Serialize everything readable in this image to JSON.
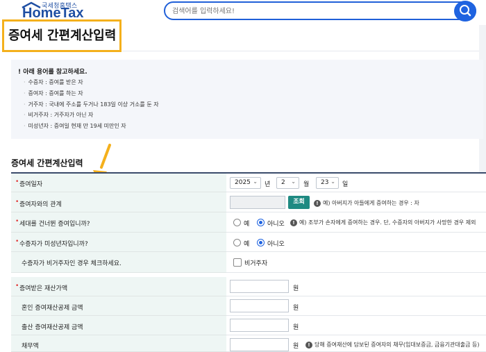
{
  "header": {
    "logo_sub": "국세청홈택스",
    "logo_main": "HomeTax",
    "search_placeholder": "검색어를 입력하세요!"
  },
  "page_title": "증여세 간편계산입력",
  "notice": {
    "heading": "! 아래 용어를 참고하세요.",
    "items": [
      "수증자 : 증여를 받은 자",
      "증여자 : 증여를 하는 자",
      "거주자 : 국내에 주소를 두거나 183일 이상 거소를 둔 자",
      "비거주자 : 거주자가 아닌 자",
      "미성년자 : 증여일 현재 만 19세 미만인 자"
    ]
  },
  "section_title": "증여세 간편계산입력",
  "form": {
    "date": {
      "label": "증여일자",
      "year": "2025",
      "year_unit": "년",
      "month": "2",
      "month_unit": "월",
      "day": "23",
      "day_unit": "일"
    },
    "relation": {
      "label": "증여자와의 관계",
      "button": "조회",
      "hint": "예) 아버지가 아들에게 증여하는 경우 : 자"
    },
    "generation_skip": {
      "label": "세대를 건너뛴 증여입니까?",
      "yes": "예",
      "no": "아니오",
      "selected": "아니오",
      "hint": "예) 조부가 손자에게 증여하는 경우. 단, 수증자의 아버지가 사망한 경우 제외"
    },
    "minor": {
      "label": "수증자가 미성년자입니까?",
      "yes": "예",
      "no": "아니오",
      "selected": "아니오"
    },
    "nonresident": {
      "label": "수증자가 비거주자인 경우 체크하세요.",
      "checkbox_label": "비거주자",
      "checked": false
    },
    "gift_value": {
      "label": "증여받은 재산가액",
      "unit": "원"
    },
    "marriage_deduction": {
      "label": "혼인 증여재산공제 금액",
      "unit": "원"
    },
    "birth_deduction": {
      "label": "출산 증여재산공제 금액",
      "unit": "원"
    },
    "debt": {
      "label": "채무액",
      "unit": "원",
      "hint": "당해 증여재산에 담보된 증여자의 채무(임대보증금, 금융기관대출금 등)"
    }
  },
  "colors": {
    "brand_blue": "#1f4fa3",
    "search_blue": "#1f63e0",
    "highlight_orange": "#f4b01c",
    "label_bg": "#eef6f4",
    "button_teal": "#1f8a82",
    "required_red": "#e03131"
  },
  "icons": [
    "search-icon",
    "info-icon",
    "chevron-down-icon",
    "arrow-annotation-icon"
  ]
}
